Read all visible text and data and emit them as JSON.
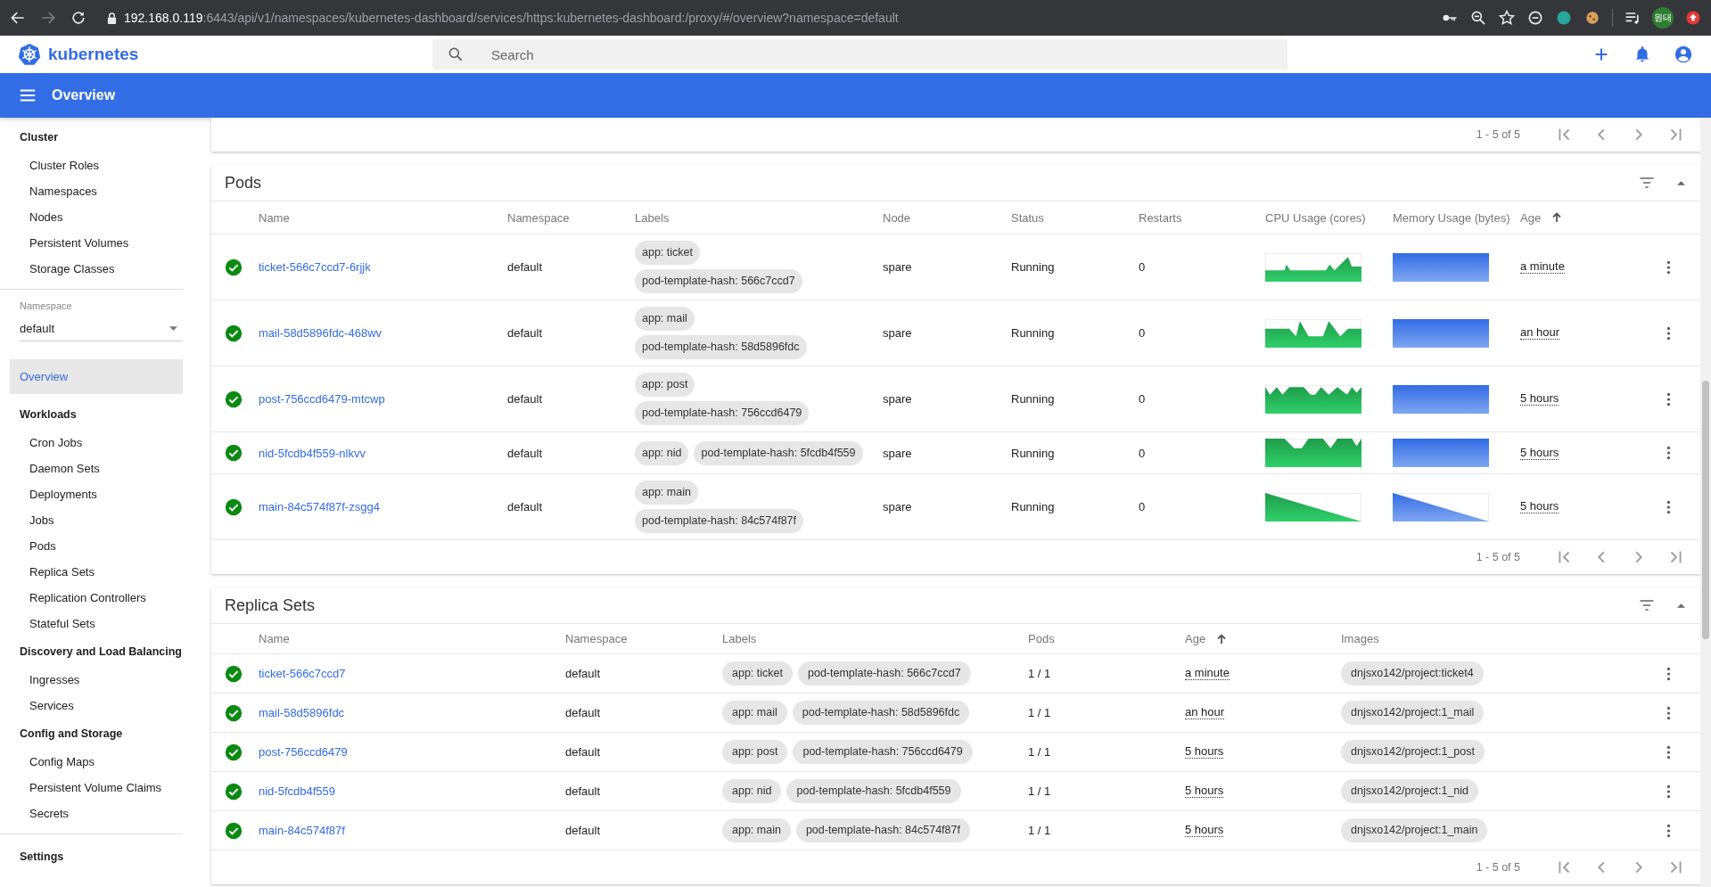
{
  "browser": {
    "url_host": "192.168.0.119",
    "url_rest": ":6443/api/v1/namespaces/kubernetes-dashboard/services/https:kubernetes-dashboard:/proxy/#/overview?namespace=default",
    "profile_label": "원태"
  },
  "header": {
    "logo_text": "kubernetes",
    "search_placeholder": "Search"
  },
  "toolbar": {
    "title": "Overview"
  },
  "sidebar": {
    "top_nav": [
      {
        "kind": "heading",
        "label": "Cluster",
        "selected": false
      },
      {
        "kind": "item",
        "label": "Cluster Roles",
        "selected": false
      },
      {
        "kind": "item",
        "label": "Namespaces",
        "selected": false
      },
      {
        "kind": "item",
        "label": "Nodes",
        "selected": false
      },
      {
        "kind": "item",
        "label": "Persistent Volumes",
        "selected": false
      },
      {
        "kind": "item",
        "label": "Storage Classes",
        "selected": false
      }
    ],
    "namespace": {
      "label": "Namespace",
      "value": "default"
    },
    "main_nav": [
      {
        "kind": "heading",
        "label": "Overview",
        "selected": true
      },
      {
        "kind": "heading",
        "label": "Workloads",
        "selected": false
      },
      {
        "kind": "item",
        "label": "Cron Jobs",
        "selected": false
      },
      {
        "kind": "item",
        "label": "Daemon Sets",
        "selected": false
      },
      {
        "kind": "item",
        "label": "Deployments",
        "selected": false
      },
      {
        "kind": "item",
        "label": "Jobs",
        "selected": false
      },
      {
        "kind": "item",
        "label": "Pods",
        "selected": false
      },
      {
        "kind": "item",
        "label": "Replica Sets",
        "selected": false
      },
      {
        "kind": "item",
        "label": "Replication Controllers",
        "selected": false
      },
      {
        "kind": "item",
        "label": "Stateful Sets",
        "selected": false
      },
      {
        "kind": "heading",
        "label": "Discovery and Load Balancing",
        "selected": false
      },
      {
        "kind": "item",
        "label": "Ingresses",
        "selected": false
      },
      {
        "kind": "item",
        "label": "Services",
        "selected": false
      },
      {
        "kind": "heading",
        "label": "Config and Storage",
        "selected": false
      },
      {
        "kind": "item",
        "label": "Config Maps",
        "selected": false
      },
      {
        "kind": "item",
        "label": "Persistent Volume Claims",
        "selected": false
      },
      {
        "kind": "item",
        "label": "Secrets",
        "selected": false
      }
    ],
    "bottom_nav": [
      {
        "kind": "heading",
        "label": "Settings",
        "selected": false
      }
    ]
  },
  "previous_card": {
    "pagination": "1 - 5 of 5"
  },
  "pods": {
    "title": "Pods",
    "columns": [
      {
        "label": "Name",
        "sorted": false
      },
      {
        "label": "Namespace",
        "sorted": false
      },
      {
        "label": "Labels",
        "sorted": false
      },
      {
        "label": "Node",
        "sorted": false
      },
      {
        "label": "Status",
        "sorted": false
      },
      {
        "label": "Restarts",
        "sorted": false
      },
      {
        "label": "CPU Usage (cores)",
        "sorted": false
      },
      {
        "label": "Memory Usage (bytes)",
        "sorted": false
      },
      {
        "label": "Age",
        "sorted": true
      }
    ],
    "rows": [
      {
        "healthy": true,
        "name": "ticket-566c7ccd7-6rjjk",
        "namespace": "default",
        "labels": [
          "app: ticket",
          "pod-template-hash: 566c7ccd7"
        ],
        "node": "spare",
        "status": "Running",
        "restarts": "0",
        "age": "a minute"
      },
      {
        "healthy": true,
        "name": "mail-58d5896fdc-468wv",
        "namespace": "default",
        "labels": [
          "app: mail",
          "pod-template-hash: 58d5896fdc"
        ],
        "node": "spare",
        "status": "Running",
        "restarts": "0",
        "age": "an hour"
      },
      {
        "healthy": true,
        "name": "post-756ccd6479-mtcwp",
        "namespace": "default",
        "labels": [
          "app: post",
          "pod-template-hash: 756ccd6479"
        ],
        "node": "spare",
        "status": "Running",
        "restarts": "0",
        "age": "5 hours"
      },
      {
        "healthy": true,
        "name": "nid-5fcdb4f559-nlkvv",
        "namespace": "default",
        "labels": [
          "app: nid",
          "pod-template-hash: 5fcdb4f559"
        ],
        "node": "spare",
        "status": "Running",
        "restarts": "0",
        "age": "5 hours"
      },
      {
        "healthy": true,
        "name": "main-84c574f87f-zsgg4",
        "namespace": "default",
        "labels": [
          "app: main",
          "pod-template-hash: 84c574f87f"
        ],
        "node": "spare",
        "status": "Running",
        "restarts": "0",
        "age": "5 hours"
      }
    ],
    "pagination": "1 - 5 of 5"
  },
  "replica_sets": {
    "title": "Replica Sets",
    "columns": [
      {
        "label": "Name",
        "sorted": false
      },
      {
        "label": "Namespace",
        "sorted": false
      },
      {
        "label": "Labels",
        "sorted": false
      },
      {
        "label": "Pods",
        "sorted": false
      },
      {
        "label": "Age",
        "sorted": true
      },
      {
        "label": "Images",
        "sorted": false
      }
    ],
    "rows": [
      {
        "healthy": true,
        "name": "ticket-566c7ccd7",
        "namespace": "default",
        "labels": [
          "app: ticket",
          "pod-template-hash: 566c7ccd7"
        ],
        "pods": "1 / 1",
        "age": "a minute",
        "images": [
          "dnjsxo142/project:ticket4"
        ]
      },
      {
        "healthy": true,
        "name": "mail-58d5896fdc",
        "namespace": "default",
        "labels": [
          "app: mail",
          "pod-template-hash: 58d5896fdc"
        ],
        "pods": "1 / 1",
        "age": "an hour",
        "images": [
          "dnjsxo142/project:1_mail"
        ]
      },
      {
        "healthy": true,
        "name": "post-756ccd6479",
        "namespace": "default",
        "labels": [
          "app: post",
          "pod-template-hash: 756ccd6479"
        ],
        "pods": "1 / 1",
        "age": "5 hours",
        "images": [
          "dnjsxo142/project:1_post"
        ]
      },
      {
        "healthy": true,
        "name": "nid-5fcdb4f559",
        "namespace": "default",
        "labels": [
          "app: nid",
          "pod-template-hash: 5fcdb4f559"
        ],
        "pods": "1 / 1",
        "age": "5 hours",
        "images": [
          "dnjsxo142/project:1_nid"
        ]
      },
      {
        "healthy": true,
        "name": "main-84c574f87f",
        "namespace": "default",
        "labels": [
          "app: main",
          "pod-template-hash: 84c574f87f"
        ],
        "pods": "1 / 1",
        "age": "5 hours",
        "images": [
          "dnjsxo142/project:1_main"
        ]
      }
    ],
    "pagination": "1 - 5 of 5"
  }
}
